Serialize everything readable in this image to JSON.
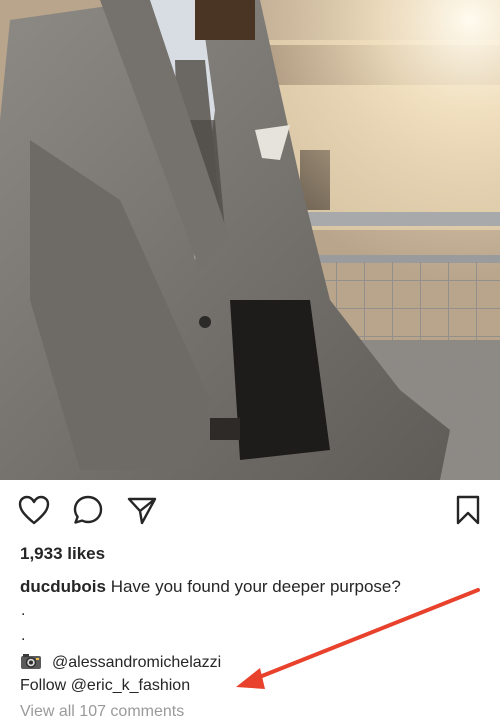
{
  "post": {
    "likes": "1,933 likes",
    "caption_user": "ducdubois",
    "caption_text": "Have you found your deeper purpose?",
    "dots": [
      ".",
      "."
    ],
    "camera_icon": "camera-icon",
    "photo_credit": "@alessandromichelazzi",
    "follow_prefix": "Follow ",
    "follow_handle": "@eric_k_fashion",
    "view_comments": "View all 107 comments"
  },
  "actions": {
    "icons": [
      "heart-icon",
      "comment-icon",
      "share-icon",
      "bookmark-icon"
    ]
  },
  "annotation": {
    "arrow_color": "#e8412c"
  },
  "colors": {
    "text": "#262626",
    "muted": "#9a9a9a"
  }
}
